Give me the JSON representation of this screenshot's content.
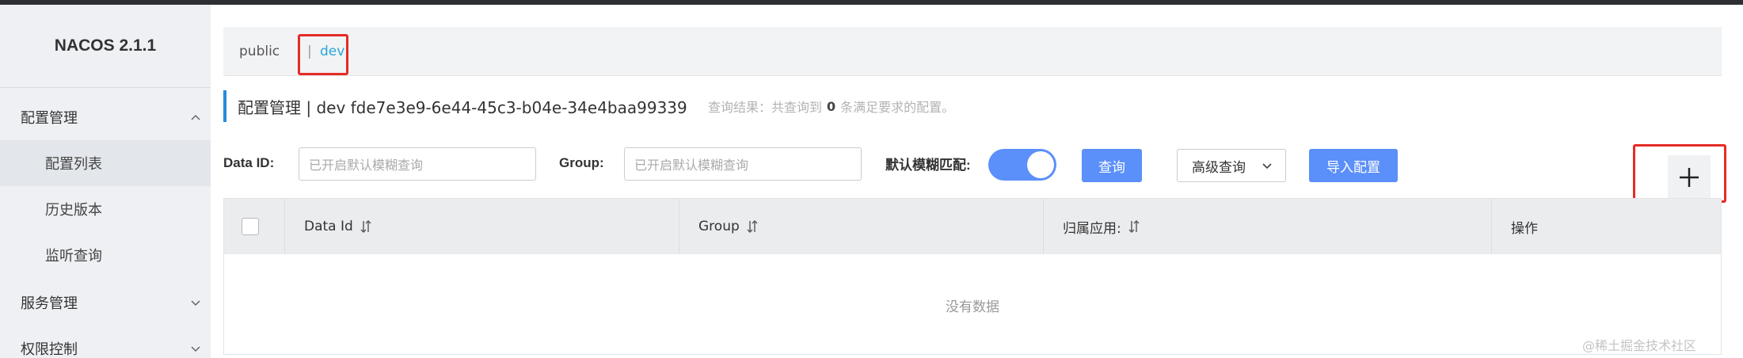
{
  "brand": {
    "title": "NACOS 2.1.1"
  },
  "sidebar": {
    "groups": [
      {
        "label": "配置管理",
        "expanded": true
      },
      {
        "label": "服务管理",
        "expanded": false
      },
      {
        "label": "权限控制",
        "expanded": false
      }
    ],
    "config_items": [
      {
        "label": "配置列表",
        "active": true
      },
      {
        "label": "历史版本",
        "active": false
      },
      {
        "label": "监听查询",
        "active": false
      }
    ]
  },
  "namespaces": {
    "items": [
      "public",
      "dev"
    ],
    "separator": "|",
    "selected": "dev"
  },
  "title": {
    "text": "配置管理 | dev fde7e3e9-6e44-45c3-b04e-34e4baa99339",
    "hint_prefix": "查询结果：共查询到",
    "hint_count": "0",
    "hint_suffix": "条满足要求的配置。"
  },
  "search": {
    "data_id_label": "Data ID:",
    "data_id_placeholder": "已开启默认模糊查询",
    "group_label": "Group:",
    "group_placeholder": "已开启默认模糊查询",
    "fuzzy_label": "默认模糊匹配:",
    "fuzzy_enabled": true,
    "query_button": "查询",
    "advanced_button": "高级查询",
    "import_button": "导入配置",
    "add_icon": "plus-icon"
  },
  "table": {
    "columns": [
      "Data Id",
      "Group",
      "归属应用:",
      "操作"
    ],
    "empty_text": "没有数据"
  },
  "watermark": "@稀土掘金技术社区",
  "colors": {
    "accent_blue": "#5b8ff9",
    "tab_active": "#2aa7d6",
    "highlight_red": "#e52b26",
    "title_accent": "#2a8bd8"
  }
}
